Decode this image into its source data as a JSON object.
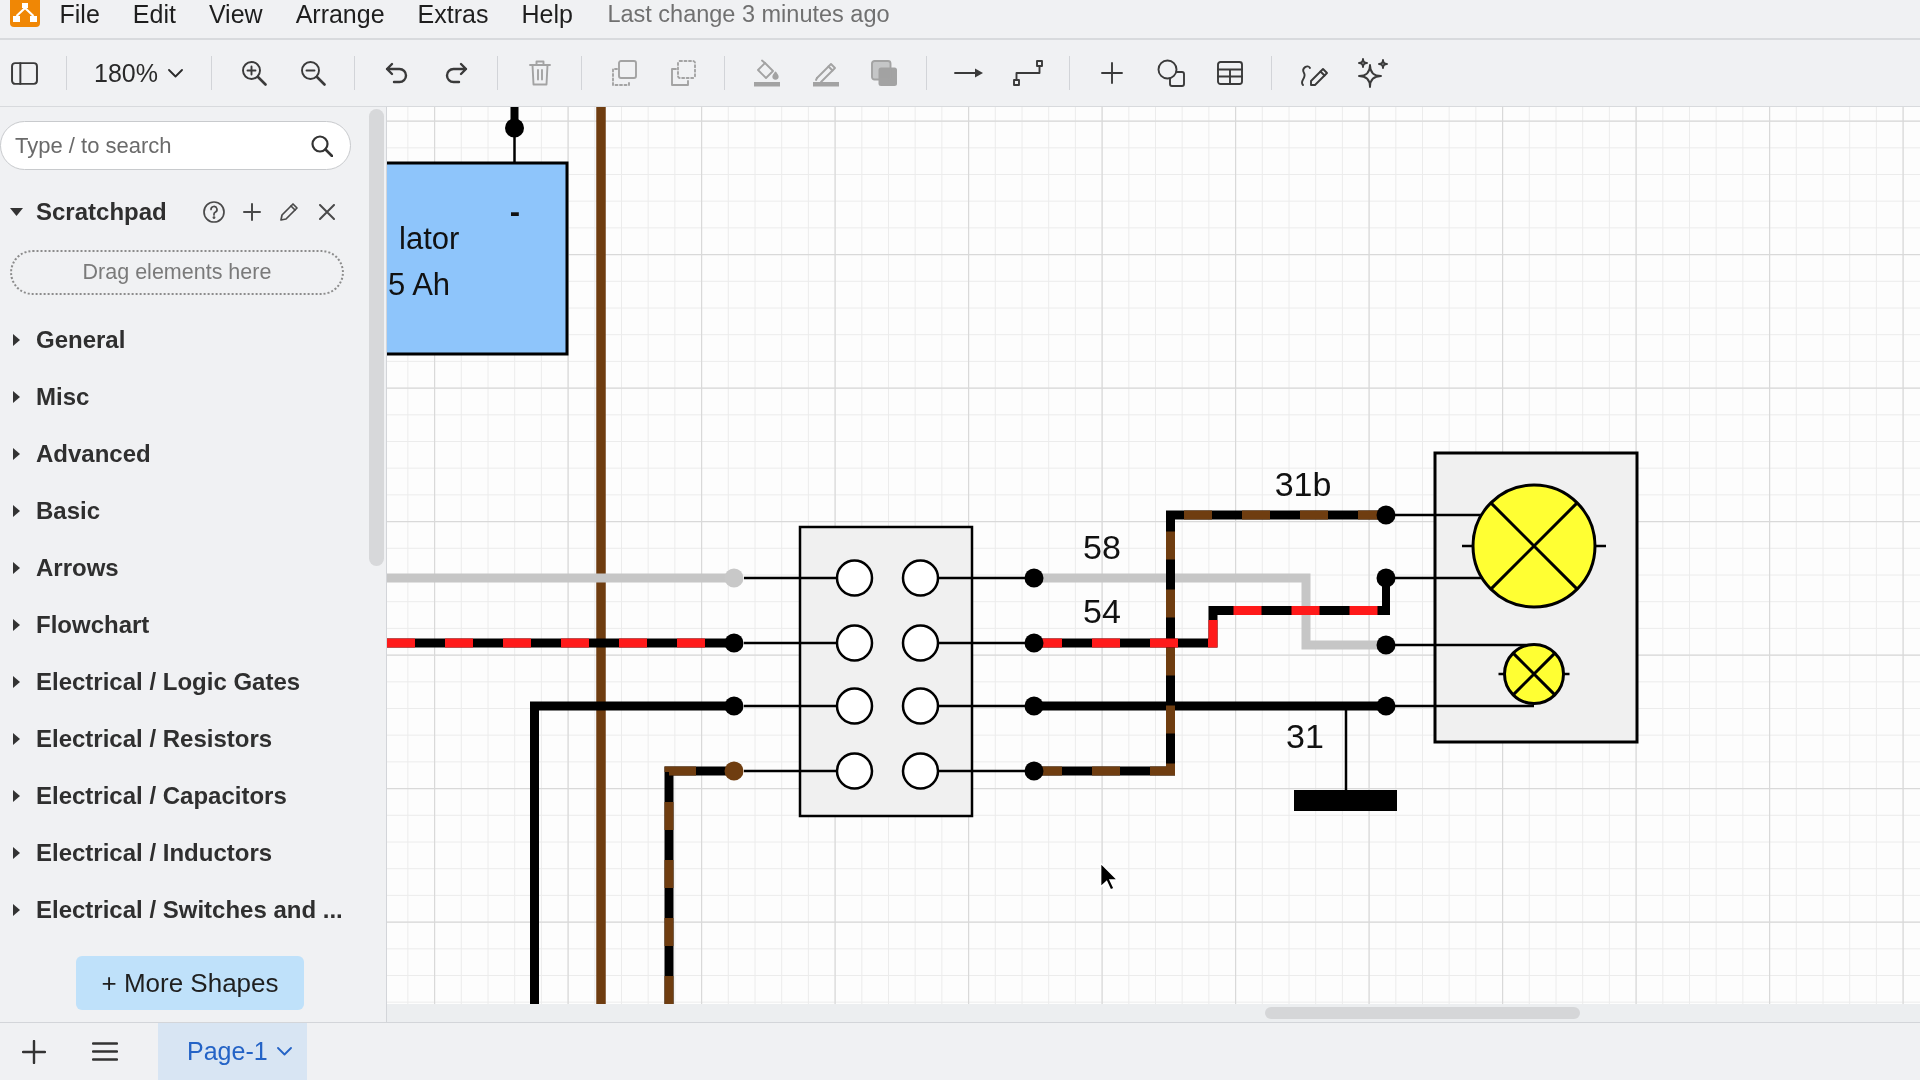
{
  "menu_bar": {
    "items": [
      "File",
      "Edit",
      "View",
      "Arrange",
      "Extras",
      "Help"
    ],
    "status": "Last change 3 minutes ago"
  },
  "toolbar": {
    "groups": [
      [
        {
          "kind": "panel",
          "disabled": false
        }
      ],
      [
        {
          "kind": "zoom",
          "value": "180%",
          "disabled": false
        }
      ],
      [
        {
          "kind": "zoomin",
          "disabled": false
        },
        {
          "kind": "zoomout",
          "disabled": false
        }
      ],
      [
        {
          "kind": "undo",
          "disabled": false
        },
        {
          "kind": "redo",
          "disabled": false
        }
      ],
      [
        {
          "kind": "delete",
          "disabled": true
        }
      ],
      [
        {
          "kind": "tofront",
          "disabled": true
        },
        {
          "kind": "toback",
          "disabled": true
        }
      ],
      [
        {
          "kind": "fill",
          "disabled": true
        },
        {
          "kind": "stroke",
          "disabled": true
        },
        {
          "kind": "shadow",
          "disabled": true
        }
      ],
      [
        {
          "kind": "connection",
          "disabled": false
        },
        {
          "kind": "waypoints",
          "disabled": false
        }
      ],
      [
        {
          "kind": "insert",
          "disabled": false
        },
        {
          "kind": "shapes",
          "disabled": false
        },
        {
          "kind": "table",
          "disabled": false
        }
      ],
      [
        {
          "kind": "freehand",
          "disabled": false
        },
        {
          "kind": "generate",
          "disabled": false
        }
      ]
    ]
  },
  "sidebar": {
    "search": {
      "placeholder": "Type / to search"
    },
    "scratchpad": {
      "title": "Scratchpad",
      "expanded": true,
      "hint": "Drag elements here"
    },
    "libraries": [
      {
        "label": "General",
        "expanded": false
      },
      {
        "label": "Misc",
        "expanded": false
      },
      {
        "label": "Advanced",
        "expanded": false
      },
      {
        "label": "Basic",
        "expanded": false
      },
      {
        "label": "Arrows",
        "expanded": false
      },
      {
        "label": "Flowchart",
        "expanded": false
      },
      {
        "label": "Electrical / Logic Gates",
        "expanded": false
      },
      {
        "label": "Electrical / Resistors",
        "expanded": false
      },
      {
        "label": "Electrical / Capacitors",
        "expanded": false
      },
      {
        "label": "Electrical / Inductors",
        "expanded": false
      },
      {
        "label": "Electrical / Switches and ...",
        "expanded": false
      }
    ],
    "more_shapes_button": "+ More Shapes"
  },
  "diagram": {
    "battery": {
      "label_lines": [
        "lator",
        "5 Ah"
      ],
      "terminal": "-"
    },
    "wire_labels": [
      "58",
      "54",
      "31b",
      "31"
    ]
  },
  "footer": {
    "pages": [
      {
        "label": "Page-1",
        "selected": true
      }
    ]
  }
}
